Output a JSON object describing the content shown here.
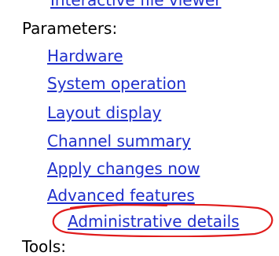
{
  "menu": {
    "cut_item_label": "Interactive file viewer",
    "parameters_heading": "Parameters:",
    "items": [
      {
        "label": "Hardware"
      },
      {
        "label": "System operation"
      },
      {
        "label": "Layout display"
      },
      {
        "label": "Channel summary"
      },
      {
        "label": "Apply changes now"
      },
      {
        "label": "Advanced features"
      },
      {
        "label": "Administrative details"
      }
    ],
    "tools_heading": "Tools:"
  },
  "highlight": {
    "shape": "ellipse",
    "color": "#e01b1b",
    "target": "Administrative details"
  }
}
